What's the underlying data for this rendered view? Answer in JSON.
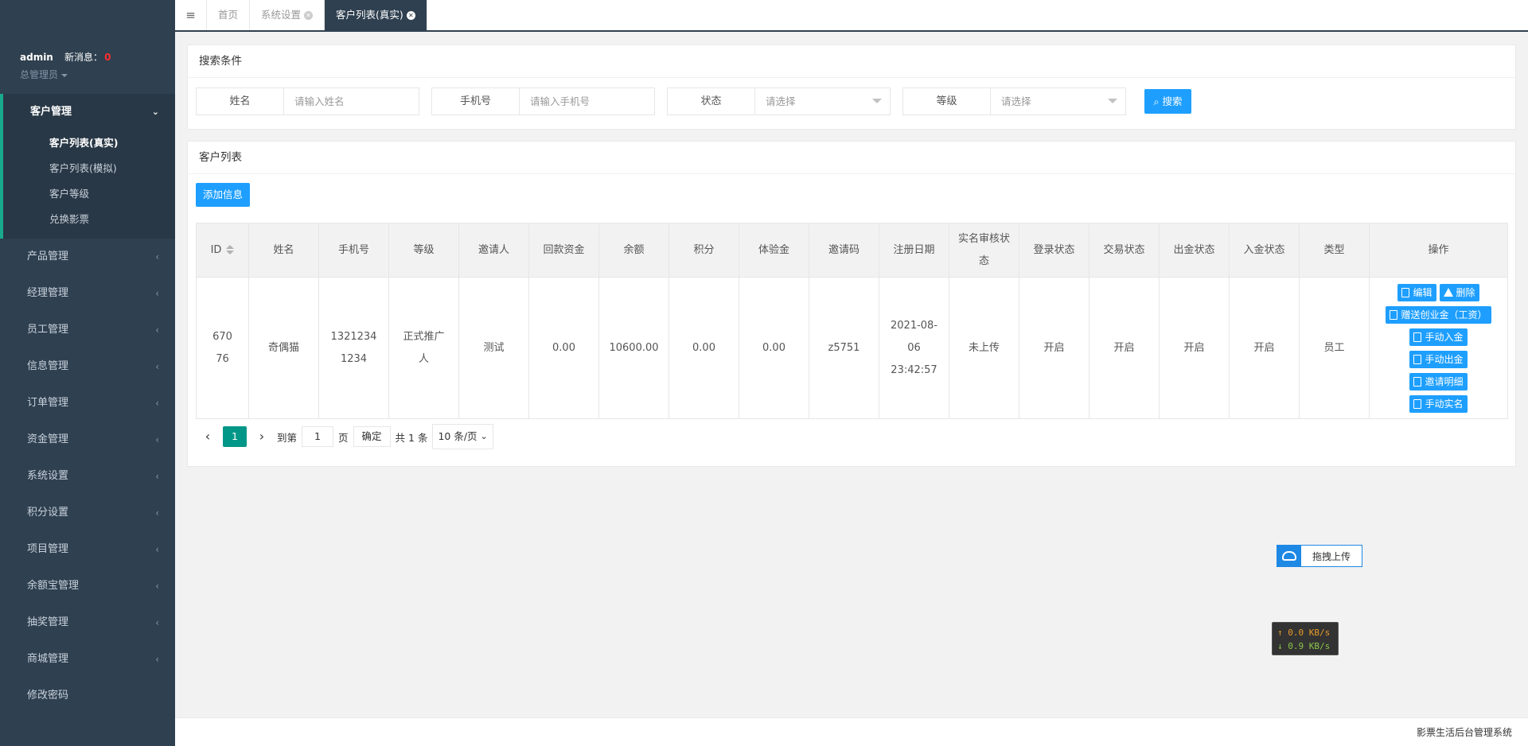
{
  "user": {
    "name": "admin",
    "message_label": "新消息：",
    "message_count": "0",
    "role": "总管理员"
  },
  "sidebar": {
    "open_group": {
      "label": "客户管理",
      "items": [
        {
          "label": "客户列表(真实)"
        },
        {
          "label": "客户列表(模拟)"
        },
        {
          "label": "客户等级"
        },
        {
          "label": "兑换影票"
        }
      ]
    },
    "items": [
      {
        "label": "产品管理"
      },
      {
        "label": "经理管理"
      },
      {
        "label": "员工管理"
      },
      {
        "label": "信息管理"
      },
      {
        "label": "订单管理"
      },
      {
        "label": "资金管理"
      },
      {
        "label": "系统设置"
      },
      {
        "label": "积分设置"
      },
      {
        "label": "项目管理"
      },
      {
        "label": "余额宝管理"
      },
      {
        "label": "抽奖管理"
      },
      {
        "label": "商城管理"
      },
      {
        "label": "修改密码"
      }
    ]
  },
  "tabs": [
    {
      "label": "首页"
    },
    {
      "label": "系统设置"
    },
    {
      "label": "客户列表(真实)"
    }
  ],
  "search": {
    "title": "搜索条件",
    "fields": [
      {
        "label": "姓名",
        "placeholder": "请输入姓名"
      },
      {
        "label": "手机号",
        "placeholder": "请输入手机号"
      },
      {
        "label": "状态",
        "placeholder": "请选择"
      },
      {
        "label": "等级",
        "placeholder": "请选择"
      }
    ],
    "button": "搜索"
  },
  "list": {
    "title": "客户列表",
    "add_button": "添加信息",
    "columns": [
      "ID",
      "姓名",
      "手机号",
      "等级",
      "邀请人",
      "回款资金",
      "余额",
      "积分",
      "体验金",
      "邀请码",
      "注册日期",
      "实名审核状态",
      "登录状态",
      "交易状态",
      "出金状态",
      "入金状态",
      "类型",
      "操作"
    ],
    "rows": [
      {
        "id": "67076",
        "name": "奇偶猫",
        "phone": "13212341234",
        "level": "正式推广人",
        "inviter": "测试",
        "return_funds": "0.00",
        "balance": "10600.00",
        "points": "0.00",
        "trial_funds": "0.00",
        "invite_code": "z5751",
        "reg_date": "2021-08-06 23:42:57",
        "realname_status": "未上传",
        "login_status": "开启",
        "trade_status": "开启",
        "withdraw_status": "开启",
        "deposit_status": "开启",
        "type": "员工"
      }
    ],
    "actions": {
      "edit": "编辑",
      "delete": "删除",
      "gift": "赠送创业金（工资）",
      "manual_deposit": "手动入金",
      "manual_withdraw": "手动出金",
      "invite_detail": "邀请明细",
      "manual_realname": "手动实名"
    }
  },
  "pager": {
    "current": "1",
    "goto_label": "到第",
    "goto_value": "1",
    "page_label": "页",
    "confirm": "确定",
    "total": "共 1 条",
    "page_size": "10 条/页"
  },
  "upload": {
    "label": "拖拽上传"
  },
  "netspeed": {
    "up": "↑ 0.0 KB/s",
    "down": "↓ 0.9 KB/s"
  },
  "footer": {
    "text": "影票生活后台管理系统"
  },
  "colors": {
    "sidebar_bg": "#2f4050",
    "primary": "#1e9fff",
    "page_active": "#009688",
    "badge": "#ff2d2d"
  }
}
